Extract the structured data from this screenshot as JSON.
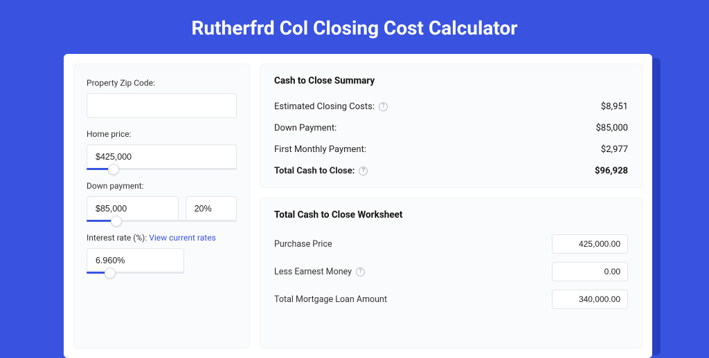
{
  "title": "Rutherfrd Col Closing Cost Calculator",
  "left": {
    "zip": {
      "label": "Property Zip Code:",
      "value": ""
    },
    "home_price": {
      "label": "Home price:",
      "value": "$425,000",
      "slider_pct": 18
    },
    "down_payment": {
      "label": "Down payment:",
      "value": "$85,000",
      "pct": "20%",
      "slider_pct": 20
    },
    "interest": {
      "label": "Interest rate (%):",
      "link": "View current rates",
      "value": "6.960%",
      "slider_pct": 24
    }
  },
  "summary": {
    "title": "Cash to Close Summary",
    "rows": [
      {
        "label": "Estimated Closing Costs:",
        "help": true,
        "value": "$8,951"
      },
      {
        "label": "Down Payment:",
        "help": false,
        "value": "$85,000"
      },
      {
        "label": "First Monthly Payment:",
        "help": false,
        "value": "$2,977"
      }
    ],
    "total": {
      "label": "Total Cash to Close:",
      "help": true,
      "value": "$96,928"
    }
  },
  "worksheet": {
    "title": "Total Cash to Close Worksheet",
    "rows": [
      {
        "label": "Purchase Price",
        "help": false,
        "value": "425,000.00"
      },
      {
        "label": "Less Earnest Money",
        "help": true,
        "value": "0.00"
      },
      {
        "label": "Total Mortgage Loan Amount",
        "help": false,
        "value": "340,000.00"
      }
    ]
  }
}
